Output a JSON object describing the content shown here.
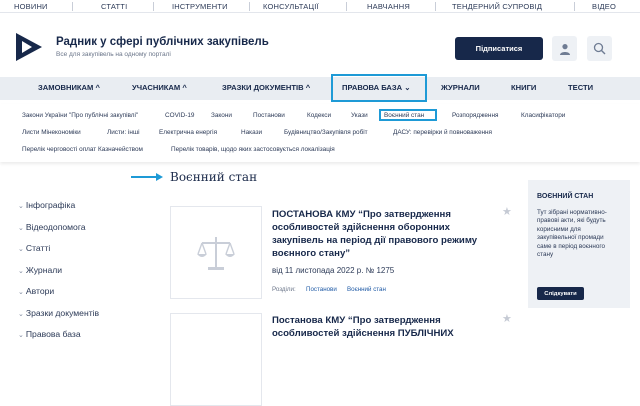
{
  "topbar": [
    "НОВИНИ",
    "СТАТТІ",
    "ІНСТРУМЕНТИ",
    "КОНСУЛЬТАЦІЇ",
    "НАВЧАННЯ",
    "ТЕНДЕРНИЙ СУПРОВІД",
    "ВІДЕО"
  ],
  "brand": {
    "title": "Радник у сфері публічних закупівель",
    "subtitle": "Все для закупівель на одному порталі"
  },
  "header": {
    "subscribe_label": "Підписатися",
    "user_icon": "user-icon",
    "search_icon": "search-icon"
  },
  "mainnav": [
    "ЗАМОВНИКАМ",
    "УЧАСНИКАМ",
    "ЗРАЗКИ ДОКУМЕНТІВ",
    "ПРАВОВА БАЗА",
    "ЖУРНАЛИ",
    "КНИГИ",
    "ТЕСТИ"
  ],
  "subnav": {
    "row1": [
      "Закони України \"Про публічні закупівлі\"",
      "COVID-19",
      "Закони",
      "Постанови",
      "Кодекси",
      "Укази",
      "Воєнний стан",
      "Розпорядження",
      "Класифікатори"
    ],
    "row2": [
      "Листи Мінекономіки",
      "Листи: інші",
      "Електрична енергія",
      "Накази",
      "Будівництво/Закупівля робіт",
      "ДАСУ: перевірки й повноваження"
    ],
    "row3": [
      "Перелік черговості оплат Казначейством",
      "Перелік товарів, щодо яких застосовується локалізація"
    ]
  },
  "sidebar": [
    "Інфографіка",
    "Відеодопомога",
    "Статті",
    "Журнали",
    "Автори",
    "Зразки документів",
    "Правова база"
  ],
  "page_title": "Воєнний стан",
  "cards": [
    {
      "title": "ПОСТАНОВА КМУ “Про затвердження особливостей здійснення оборонних закупівель на період дії правового режиму воєнного стану”",
      "meta": "від 11 листопада 2022 р. № 1275",
      "sections_label": "Розділи:",
      "sections": [
        "Постанови",
        "Воєнний стан"
      ]
    },
    {
      "title": "Постанова КМУ “Про затвердження особливостей здійснення ПУБЛІЧНИХ"
    }
  ],
  "side_box": {
    "heading": "ВОЄННИЙ СТАН",
    "text": "Тут зібрані нормативно-правові акти, які будуть корисними для закупівельної промади саме в період воєнного стану",
    "button": "Слідкувати"
  },
  "colors": {
    "navy": "#17284a",
    "highlight": "#1e9ad6",
    "nav_bg": "#e9edf2"
  }
}
